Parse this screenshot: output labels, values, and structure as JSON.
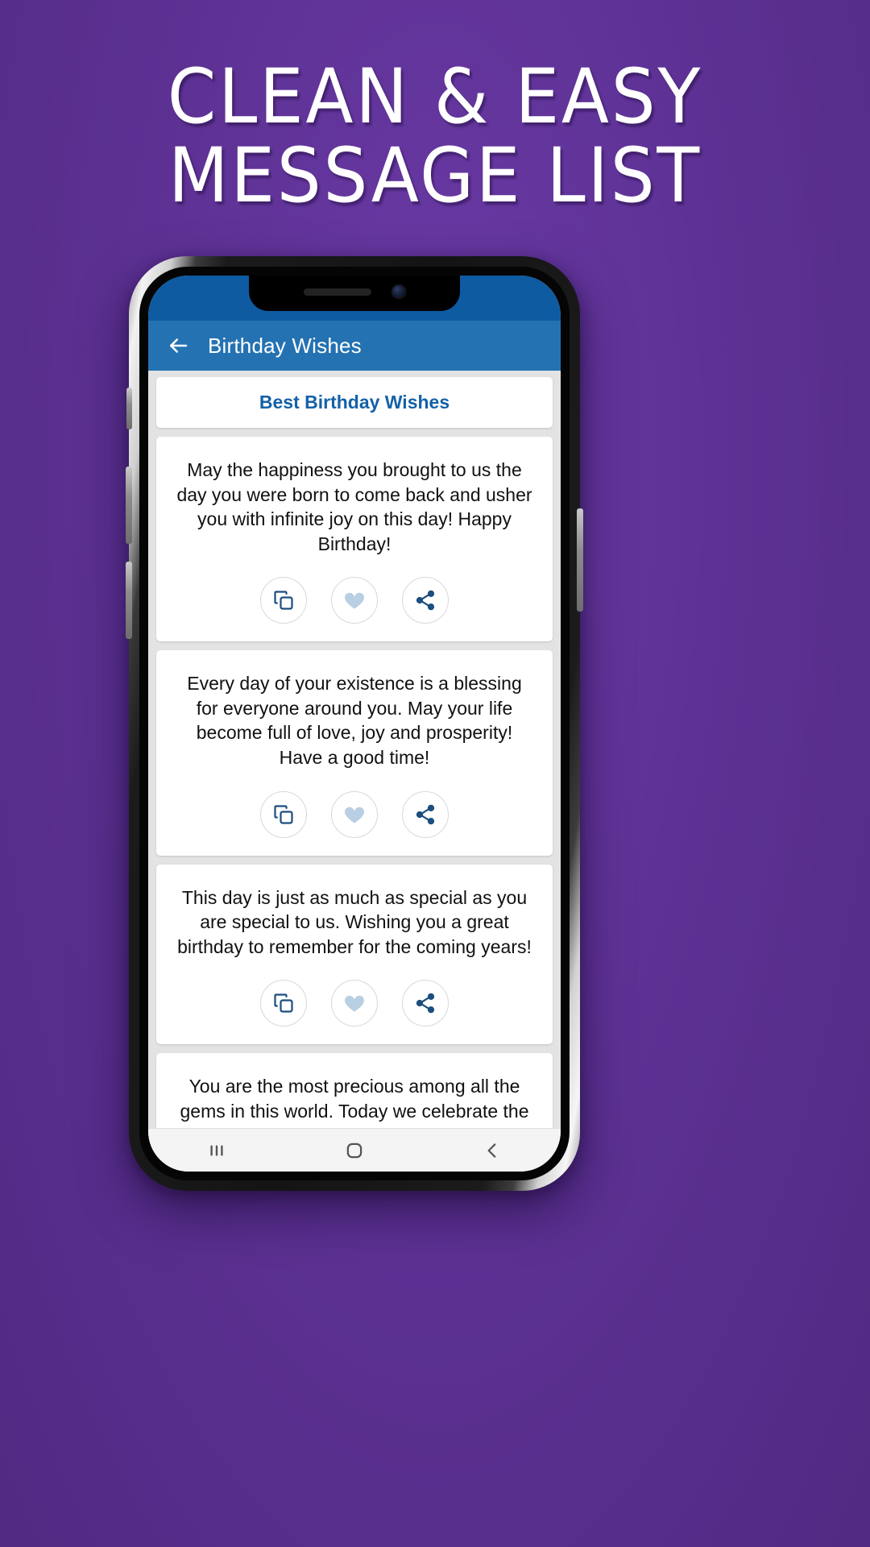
{
  "poster": {
    "background_color": "#5b3091",
    "headline_lines": [
      "CLEAN & EASY",
      "MESSAGE LIST"
    ]
  },
  "phone": {
    "status_bar_color": "#0e5ba2",
    "app_bar_color": "#2472b2",
    "list_background_color": "#e3e3e3"
  },
  "app_bar": {
    "back_icon": "arrow-left-icon",
    "title": "Birthday Wishes"
  },
  "header_card": {
    "title": "Best Birthday Wishes",
    "color": "#1461a8"
  },
  "actions": {
    "copy_icon": "copy-icon",
    "favorite_icon": "heart-icon",
    "share_icon": "share-icon",
    "copy_color": "#1c4e7e",
    "favorite_color": "#b8cfe4",
    "share_color": "#1c4e7e"
  },
  "messages": [
    {
      "text": "May the happiness you brought to us the day you were born to come back and usher you with infinite joy on this day! Happy Birthday!"
    },
    {
      "text": "Every day of your existence is a blessing for everyone around you. May your life become full of love, joy and prosperity! Have a good time!"
    },
    {
      "text": "This day is just as much as special as you are special to us. Wishing you a great birthday to remember for the coming years!"
    },
    {
      "text": "You are the most precious among all the gems in this world. Today we celebrate the day when a star was born not in the sky but on the earth!"
    }
  ],
  "nav_bar": {
    "recents_icon": "recents-icon",
    "home_icon": "home-icon",
    "back_icon": "back-chevron-icon"
  }
}
